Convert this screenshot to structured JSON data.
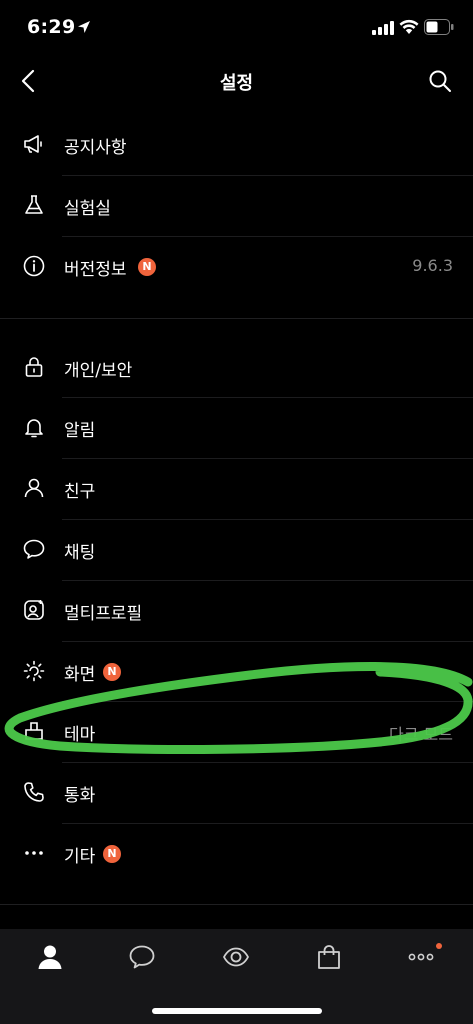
{
  "status_bar": {
    "time": "6:29"
  },
  "header": {
    "title": "설정"
  },
  "section1": [
    {
      "label": "공지사항",
      "icon": "megaphone-icon"
    },
    {
      "label": "실험실",
      "icon": "flask-icon"
    },
    {
      "label": "버전정보",
      "icon": "info-icon",
      "badge": "N",
      "value": "9.6.3"
    }
  ],
  "section2": [
    {
      "label": "개인/보안",
      "icon": "lock-icon"
    },
    {
      "label": "알림",
      "icon": "bell-icon"
    },
    {
      "label": "친구",
      "icon": "person-icon"
    },
    {
      "label": "채팅",
      "icon": "chat-bubble-icon"
    },
    {
      "label": "멀티프로필",
      "icon": "multi-profile-icon"
    },
    {
      "label": "화면",
      "icon": "brightness-icon",
      "badge": "N"
    },
    {
      "label": "테마",
      "icon": "theme-icon",
      "value": "다크 모드"
    },
    {
      "label": "통화",
      "icon": "phone-icon"
    },
    {
      "label": "기타",
      "icon": "more-dots-icon",
      "badge": "N"
    }
  ],
  "tab_bar": {
    "tabs": [
      "friends-tab",
      "chats-tab",
      "view-tab",
      "shopping-tab",
      "more-tab"
    ]
  },
  "colors": {
    "background": "#000000",
    "badge": "#f0643c",
    "secondary_text": "#8a8a8a",
    "tab_bar": "#161618",
    "annotation": "#4cc94a"
  }
}
